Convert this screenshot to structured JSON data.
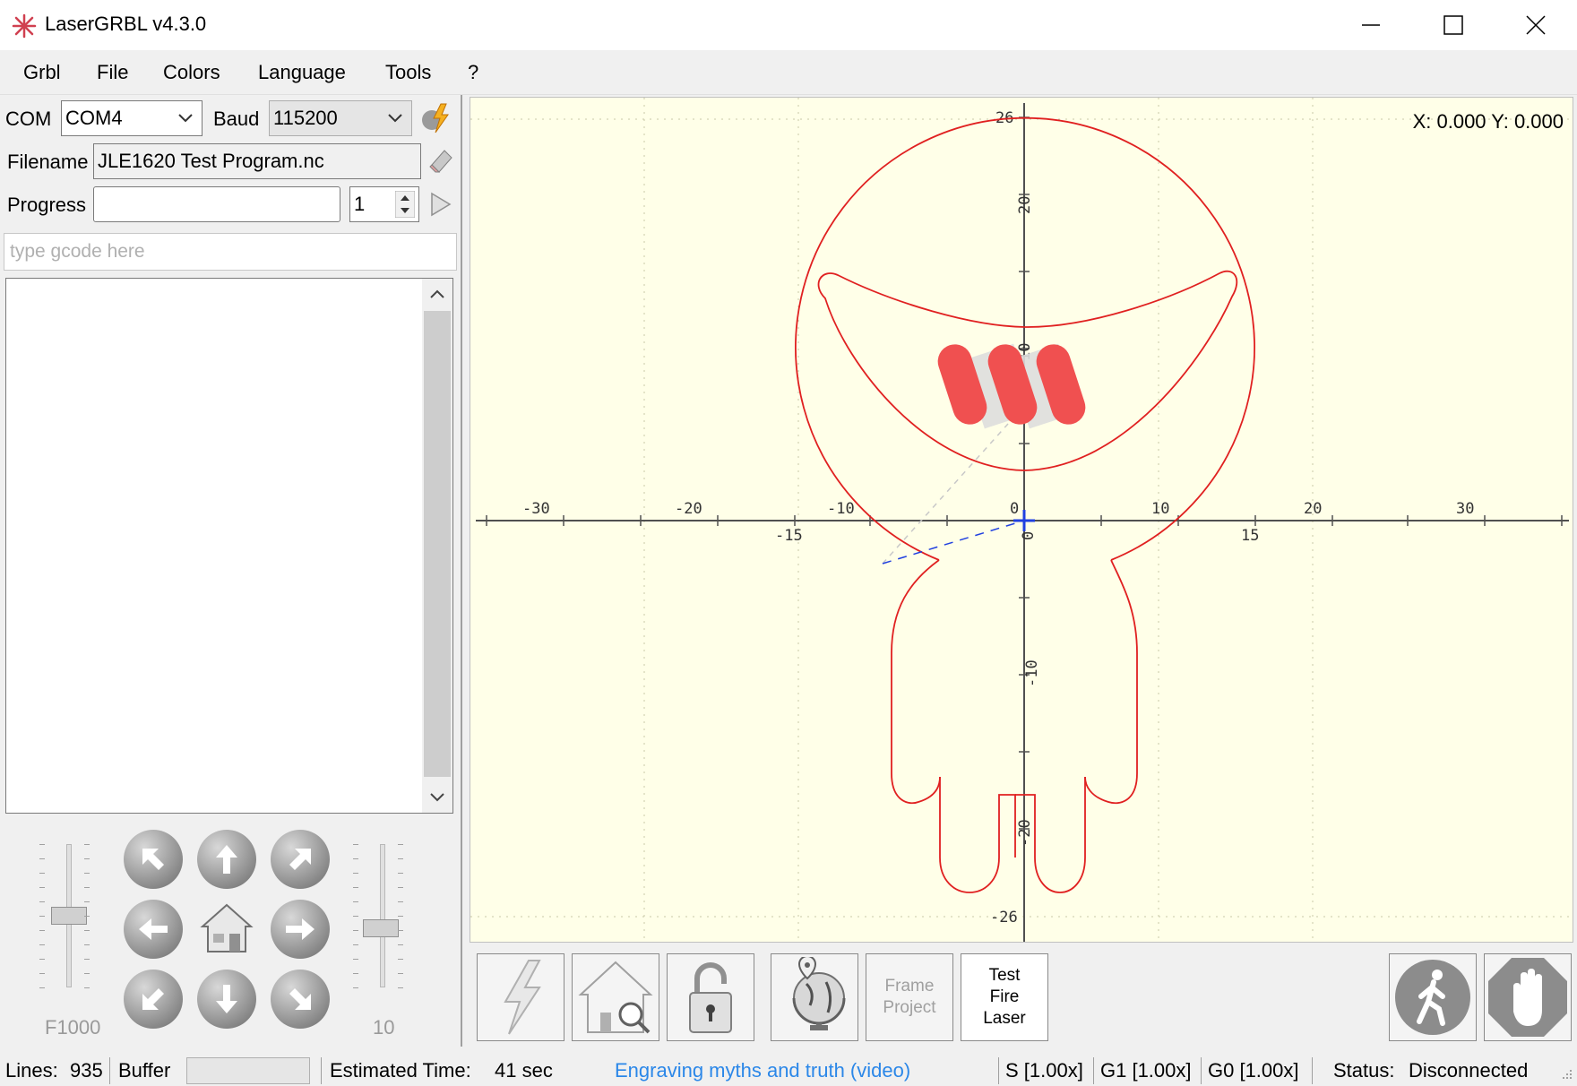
{
  "window": {
    "title": "LaserGRBL v4.3.0",
    "minimize_icon": "minimize-icon",
    "maximize_icon": "maximize-icon",
    "close_icon": "close-icon"
  },
  "menu": [
    "Grbl",
    "File",
    "Colors",
    "Language",
    "Tools",
    "?"
  ],
  "connection": {
    "com_label": "COM",
    "com_value": "COM4",
    "baud_label": "Baud",
    "baud_value": "115200",
    "connect_icon": "connect-lightning-icon"
  },
  "file": {
    "filename_label": "Filename",
    "filename_value": "JLE1620 Test Program.nc",
    "progress_label": "Progress",
    "progress_value": 0,
    "repeat_count": "1"
  },
  "gcode": {
    "placeholder": "type gcode here"
  },
  "jog": {
    "speed_label": "F1000",
    "step_label": "10",
    "speed_level": 0.5,
    "step_level": 0.4
  },
  "canvas": {
    "coord_readout": "X: 0.000 Y: 0.000",
    "axis_x_ticks_top": [
      "-30",
      "-20",
      "-10",
      "0",
      "10",
      "20",
      "30"
    ],
    "axis_x_ticks_bottom": [
      "-15",
      "15"
    ],
    "axis_y_ticks": [
      "26",
      "20",
      "10",
      "0",
      "-10",
      "-20",
      "-26"
    ],
    "drawing_color": "#e02020",
    "fill_color": "#f05050",
    "background": "#ffffe8"
  },
  "toolbar": {
    "frame_project": "Frame Project",
    "test_fire_laser": "Test Fire Laser",
    "buttons_icons": [
      "reset-lightning-icon",
      "home-search-icon",
      "unlock-padlock-icon",
      "globe-location-icon",
      "resume-walking-icon",
      "stop-hand-icon"
    ]
  },
  "status": {
    "lines_label": "Lines:",
    "lines_value": "935",
    "buffer_label": "Buffer",
    "est_label": "Estimated Time:",
    "est_value": "41 sec",
    "link_text": "Engraving myths and truth (video)",
    "s_override": "S [1.00x]",
    "g1_override": "G1 [1.00x]",
    "g0_override": "G0 [1.00x]",
    "status_label": "Status:",
    "status_value": "Disconnected"
  }
}
